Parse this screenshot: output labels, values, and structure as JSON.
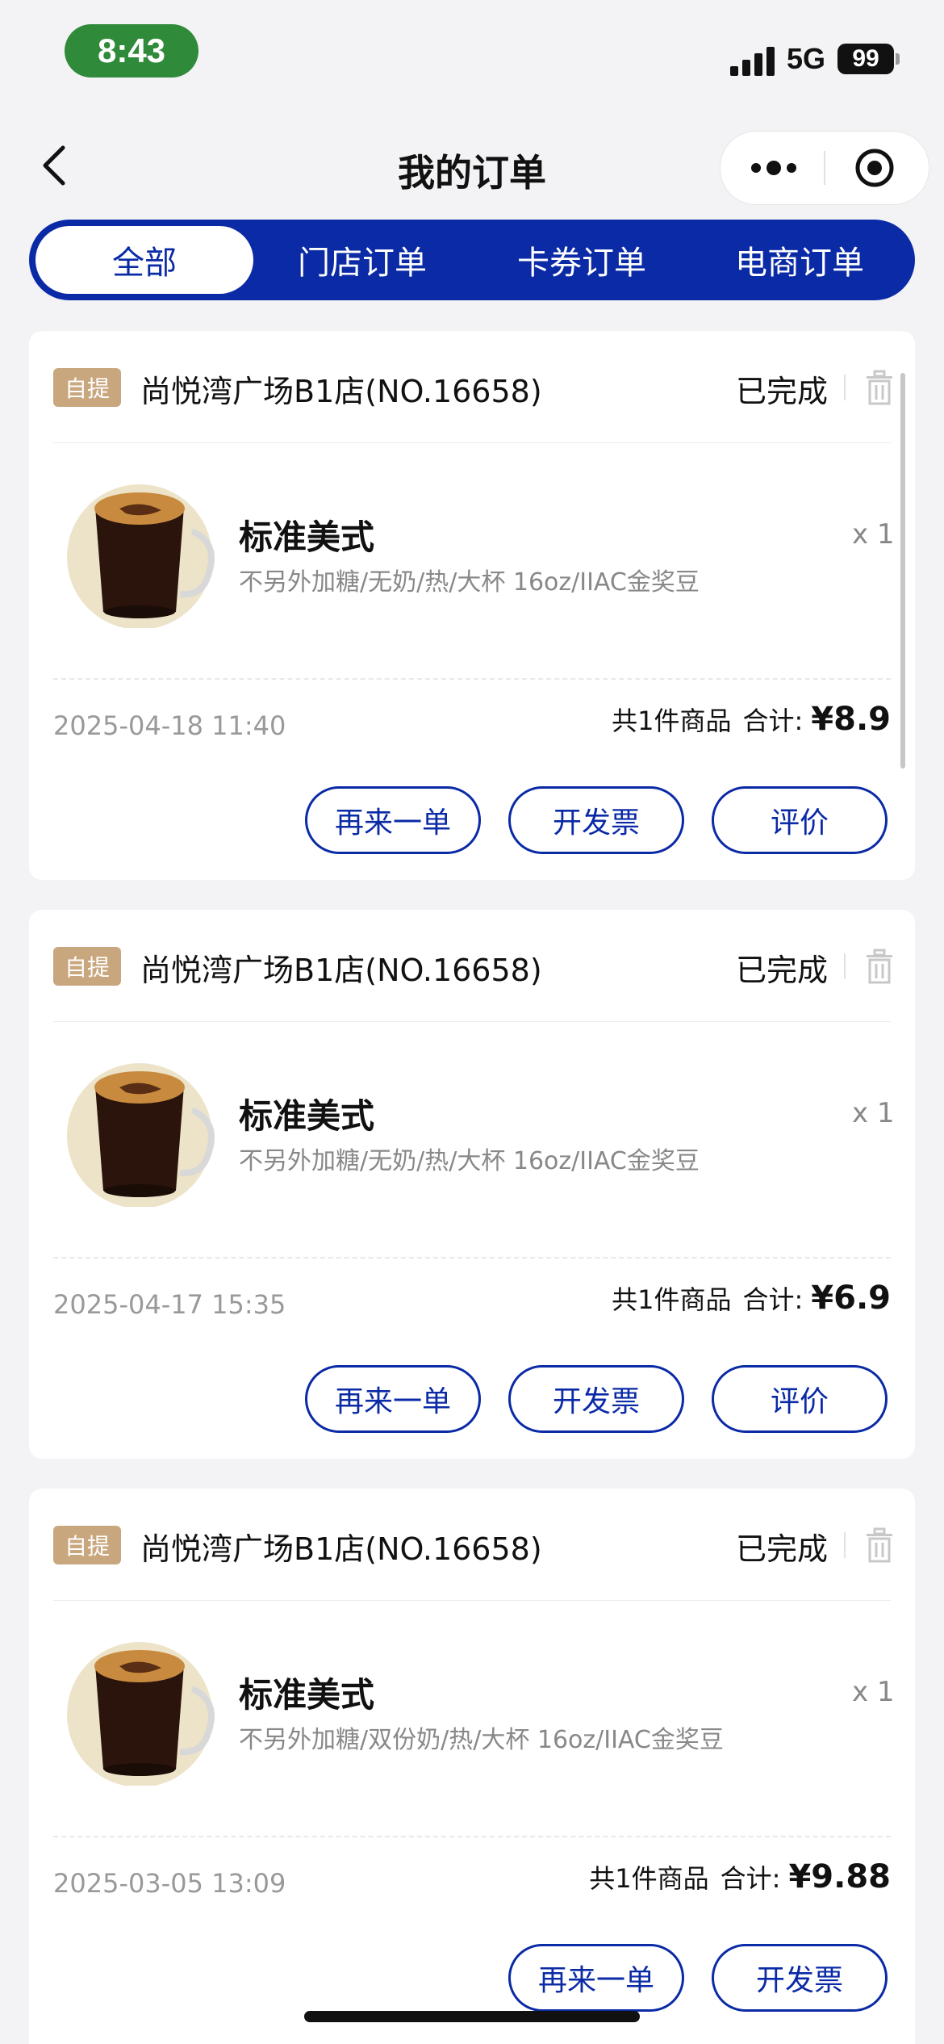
{
  "status_bar": {
    "time": "8:43",
    "network": "5G",
    "battery": "99"
  },
  "nav": {
    "title": "我的订单"
  },
  "tabs": [
    {
      "label": "全部",
      "active": true
    },
    {
      "label": "门店订单",
      "active": false
    },
    {
      "label": "卡券订单",
      "active": false
    },
    {
      "label": "电商订单",
      "active": false
    }
  ],
  "orders": [
    {
      "badge": "自提",
      "store": "尚悦湾广场B1店(NO.16658)",
      "status": "已完成",
      "product": {
        "name": "标准美式",
        "spec": "不另外加糖/无奶/热/大杯 16oz/IIAC金奖豆",
        "qty": "x 1"
      },
      "date": "2025-04-18 11:40",
      "count": "共1件商品",
      "total_label": "合计:",
      "price": "¥8.9",
      "buttons": [
        "再来一单",
        "开发票",
        "评价"
      ]
    },
    {
      "badge": "自提",
      "store": "尚悦湾广场B1店(NO.16658)",
      "status": "已完成",
      "product": {
        "name": "标准美式",
        "spec": "不另外加糖/无奶/热/大杯 16oz/IIAC金奖豆",
        "qty": "x 1"
      },
      "date": "2025-04-17 15:35",
      "count": "共1件商品",
      "total_label": "合计:",
      "price": "¥6.9",
      "buttons": [
        "再来一单",
        "开发票",
        "评价"
      ]
    },
    {
      "badge": "自提",
      "store": "尚悦湾广场B1店(NO.16658)",
      "status": "已完成",
      "product": {
        "name": "标准美式",
        "spec": "不另外加糖/双份奶/热/大杯 16oz/IIAC金奖豆",
        "qty": "x 1"
      },
      "date": "2025-03-05 13:09",
      "count": "共1件商品",
      "total_label": "合计:",
      "price": "¥9.88",
      "buttons": [
        "再来一单",
        "开发票"
      ]
    }
  ],
  "colors": {
    "brand_blue": "#0a2aa6",
    "badge_tan": "#c9a77e",
    "time_pill_green": "#2f8a3a"
  },
  "icons": [
    "back-arrow-icon",
    "more-dots-icon",
    "target-icon",
    "trash-icon",
    "coffee-cup-icon"
  ]
}
